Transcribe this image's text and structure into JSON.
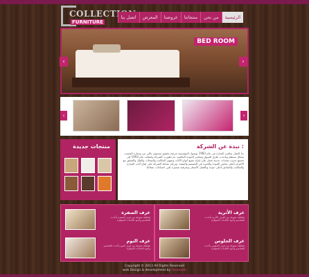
{
  "brand": {
    "line1": "COLLECTION",
    "line2": "FURNITURE"
  },
  "nav": {
    "items": [
      "الرئيسية",
      "من نحن",
      "منتجاتنا",
      "عروضنا",
      "المعرض",
      "اتصل بنا"
    ]
  },
  "slider": {
    "caption": "BED ROOM",
    "prev": "‹",
    "next": "›"
  },
  "thumbs": {
    "prev": "‹",
    "next": "›"
  },
  "new_products": {
    "title": "منتجات جديدة"
  },
  "about": {
    "title": "نبذة عن الشركة :",
    "body": "بدأ العمل بمكتب النجارة في عام 1983 بوصول المؤسسة غرضه تحقيق مستوى عالي من ونجارة الخشب بشكل منتظم وبأحدث طرق السوق ومعايير الجودة العالمية. ثم تطورت الشركة وانتقلت عام 1993 إلى مصنع حديث بمعدات حديثة تعمل على إنتاج جميع أنواع الأثاث وتجهيز المكاتب والمحلات والفلل والشقق مع الالتزام بأعلى معايير الجودة والخبرة في التصميم والتنفيذ. ويرتكز نشاط الشركة على إنتاج أثاث المنازل والمكاتب والفنادق بأعلى جودة وبأفضل الأسعار وبحرفية متميزة تلبي احتياجات عملائنا."
  },
  "categories": [
    {
      "name": "غرف الصفرة",
      "desc": "تشكيلة متنوعة من غرف الصفرة بأحدث التصاميم وأجود الخامات المتوفرة"
    },
    {
      "name": "غرف الأثرية",
      "desc": "تشكيلة متنوعة من الغرف الأثرية بأحدث التصاميم وأجود الخامات المتوفرة"
    },
    {
      "name": "غرف النوم",
      "desc": "تشكيلة متنوعة من غرف النوم بأحدث التصاميم وأجود الخامات المتوفرة"
    },
    {
      "name": "غرف الجلوس",
      "desc": "تشكيلة متنوعة من غرف الجلوس بأحدث التصاميم وأجود الخامات المتوفرة"
    }
  ],
  "footer": {
    "copyright": "Copyright © 2013 All Rights Reserved",
    "credit_prefix": "web Design & development by",
    "credit_brand": "Tasmeem"
  },
  "colors": {
    "accent": "#b02463",
    "accent_light": "#e1478f",
    "background": "#3a2418"
  }
}
